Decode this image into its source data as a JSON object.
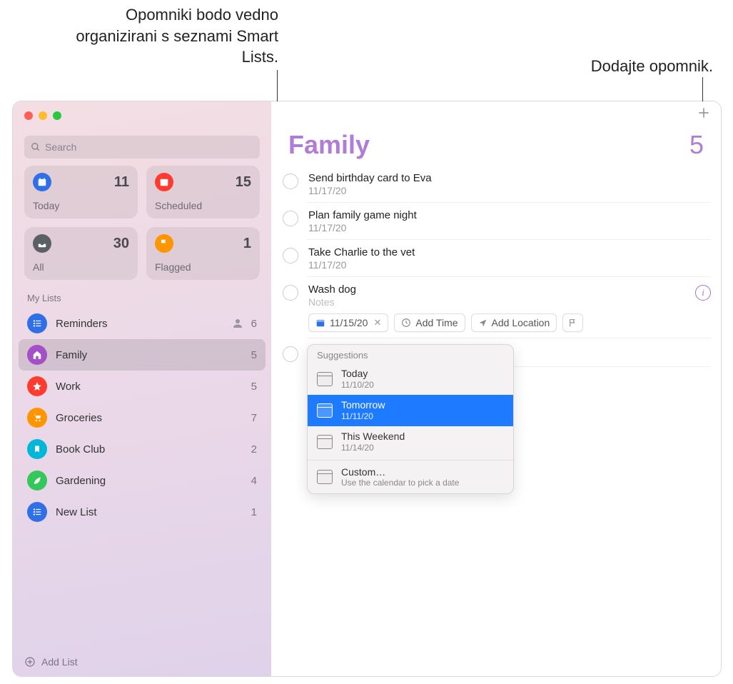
{
  "callouts": {
    "smartlists": "Opomniki bodo vedno organizirani s seznami Smart Lists.",
    "add_reminder": "Dodajte opomnik."
  },
  "search": {
    "placeholder": "Search"
  },
  "cards": {
    "today": {
      "label": "Today",
      "count": "11"
    },
    "scheduled": {
      "label": "Scheduled",
      "count": "15"
    },
    "all": {
      "label": "All",
      "count": "30"
    },
    "flagged": {
      "label": "Flagged",
      "count": "1"
    }
  },
  "my_lists_label": "My Lists",
  "lists": [
    {
      "name": "Reminders",
      "count": "6",
      "shared": true,
      "color": "#2f6fe8"
    },
    {
      "name": "Family",
      "count": "5",
      "shared": false,
      "color": "#a44fc8",
      "selected": true
    },
    {
      "name": "Work",
      "count": "5",
      "shared": false,
      "color": "#ff3b30"
    },
    {
      "name": "Groceries",
      "count": "7",
      "shared": false,
      "color": "#ff9500"
    },
    {
      "name": "Book Club",
      "count": "2",
      "shared": false,
      "color": "#00b7d9"
    },
    {
      "name": "Gardening",
      "count": "4",
      "shared": false,
      "color": "#34c759"
    },
    {
      "name": "New List",
      "count": "1",
      "shared": false,
      "color": "#2f6fe8"
    }
  ],
  "add_list_label": "Add List",
  "main": {
    "title": "Family",
    "title_color": "#b17cd5",
    "total": "5",
    "reminders": [
      {
        "title": "Send birthday card to Eva",
        "date": "11/17/20"
      },
      {
        "title": "Plan family game night",
        "date": "11/17/20"
      },
      {
        "title": "Take Charlie to the vet",
        "date": "11/17/20"
      },
      {
        "title": "Wash dog",
        "notes": "Notes",
        "editing": true
      }
    ],
    "chips": {
      "date_value": "11/15/20",
      "add_time": "Add Time",
      "add_location": "Add Location"
    },
    "suggestions": {
      "header": "Suggestions",
      "items": [
        {
          "title": "Today",
          "sub": "11/10/20"
        },
        {
          "title": "Tomorrow",
          "sub": "11/11/20",
          "selected": true
        },
        {
          "title": "This Weekend",
          "sub": "11/14/20"
        }
      ],
      "custom": {
        "title": "Custom…",
        "sub": "Use the calendar to pick a date"
      }
    }
  }
}
